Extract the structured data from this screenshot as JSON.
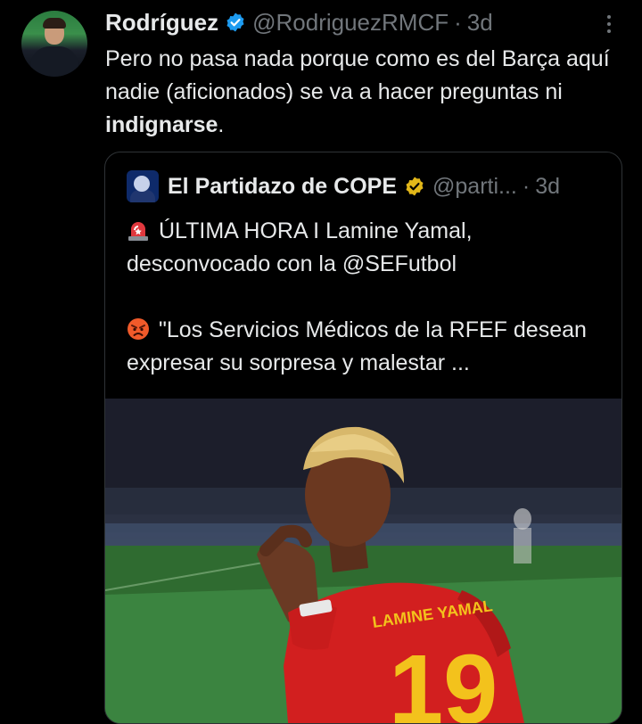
{
  "tweet": {
    "display_name": "Rodríguez",
    "handle": "@RodriguezRMCF",
    "separator": "·",
    "time": "3d",
    "text_plain": "Pero no pasa nada porque como es del Barça aquí nadie (aficionados) se va a hacer preguntas ni ",
    "text_bold": "indignarse",
    "text_end": "."
  },
  "quoted": {
    "display_name": "El Partidazo de COPE",
    "handle": "@parti...",
    "separator": "·",
    "time": "3d",
    "line1": "ÚLTIMA HORA I Lamine Yamal, desconvocado con la @SEFutbol",
    "line2": "\"Los Servicios Médicos de la RFEF desean expresar su sorpresa y malestar ...",
    "image_text": {
      "shirt_name": "LAMINE YAMAL",
      "shirt_number": "19"
    }
  },
  "colors": {
    "background": "#000000",
    "text": "#e7e9ea",
    "muted": "#71767b",
    "verified_blue": "#1d9bf0",
    "verified_gold": "#e2b719",
    "border": "#2f3336"
  },
  "icons": {
    "verified": "verified-badge-icon",
    "affiliate": "gold-verified-badge-icon",
    "more": "more-options-icon",
    "siren": "rotating-light-emoji",
    "angry": "angry-face-emoji"
  }
}
